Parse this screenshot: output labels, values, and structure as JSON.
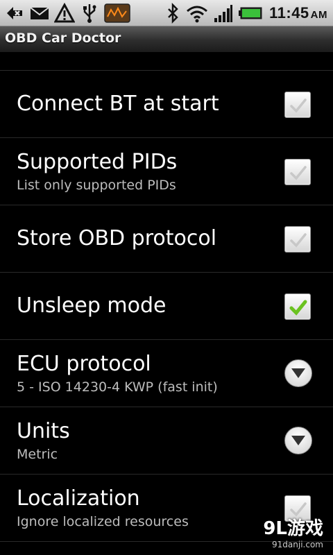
{
  "statusbar": {
    "time": "11:45",
    "ampm": "AM",
    "left_icons": [
      "usb-debug-icon",
      "mail-icon",
      "warning-icon",
      "usb-icon",
      "obd-app-icon"
    ],
    "right_icons": [
      "bluetooth-icon",
      "wifi-icon",
      "signal-icon",
      "battery-icon"
    ]
  },
  "app": {
    "title": "OBD Car Doctor"
  },
  "preferences": [
    {
      "label": "Connect BT at start",
      "summary": "",
      "control": "checkbox",
      "checked": false
    },
    {
      "label": "Supported PIDs",
      "summary": "List only supported PIDs",
      "control": "checkbox",
      "checked": false
    },
    {
      "label": "Store OBD protocol",
      "summary": "",
      "control": "checkbox",
      "checked": false
    },
    {
      "label": "Unsleep mode",
      "summary": "",
      "control": "checkbox",
      "checked": true
    },
    {
      "label": "ECU protocol",
      "summary": "5 - ISO 14230-4 KWP (fast init)",
      "control": "dropdown"
    },
    {
      "label": "Units",
      "summary": "Metric",
      "control": "dropdown"
    },
    {
      "label": "Localization",
      "summary": "Ignore localized resources",
      "control": "checkbox",
      "checked": false
    }
  ],
  "watermark": {
    "logo": "9L游戏",
    "url": "91danji.com"
  },
  "colors": {
    "check_on": "#6bc21f",
    "check_off": "#c8c8c8",
    "summary_text": "#bdbdbd"
  }
}
